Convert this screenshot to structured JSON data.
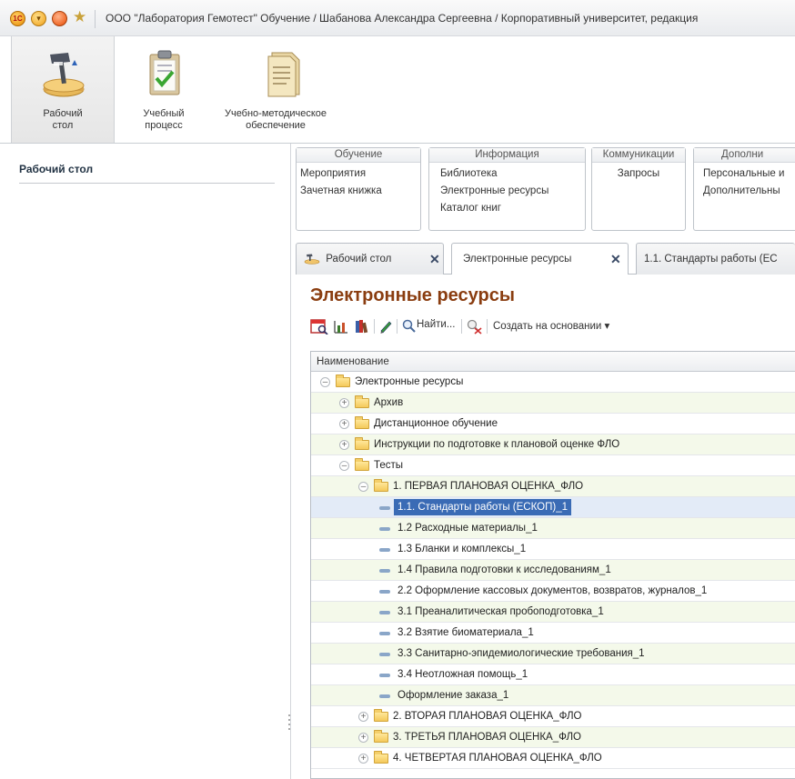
{
  "window": {
    "title": "ООО \"Лаборатория Гемотест\" Обучение / Шабанова Александра Сергеевна / Корпоративный университет, редакция"
  },
  "sections": [
    {
      "label": "Рабочий\nстол",
      "line1": "Рабочий",
      "line2": "стол",
      "icon": "desk-lamp-icon"
    },
    {
      "label": "Учебный процесс",
      "line1": "Учебный",
      "line2": "процесс",
      "icon": "clipboard-check-icon"
    },
    {
      "label": "Учебно-методическое обеспечение",
      "line1": "Учебно-методическое",
      "line2": "обеспечение",
      "icon": "document-icon"
    }
  ],
  "left_panel": {
    "title": "Рабочий стол"
  },
  "groups": [
    {
      "title": "Обучение",
      "items": [
        "Мероприятия",
        "Зачетная книжка"
      ]
    },
    {
      "title": "Информация",
      "items": [
        "Библиотека",
        "Электронные ресурсы",
        "Каталог книг"
      ]
    },
    {
      "title": "Коммуникации",
      "items": [
        "Запросы"
      ]
    },
    {
      "title": "Дополни",
      "items": [
        "Персональные и",
        "Дополнительны"
      ]
    }
  ],
  "tabs": [
    {
      "label": "Рабочий стол",
      "active": false
    },
    {
      "label": "Электронные ресурсы",
      "active": true
    },
    {
      "label": "1.1. Стандарты работы (ЕС",
      "active": false
    }
  ],
  "content": {
    "title": "Электронные ресурсы",
    "toolbar": {
      "find_label": "Найти...",
      "create_based_label": "Создать на основании ▾"
    },
    "grid": {
      "column": "Наименование",
      "rows": [
        {
          "label": "Электронные ресурсы",
          "level": 0,
          "type": "folder",
          "state": "open"
        },
        {
          "label": "Архив",
          "level": 1,
          "type": "folder",
          "state": "closed"
        },
        {
          "label": "Дистанционное обучение",
          "level": 1,
          "type": "folder",
          "state": "closed"
        },
        {
          "label": "Инструкции по подготовке к плановой оценке ФЛО",
          "level": 1,
          "type": "folder",
          "state": "closed"
        },
        {
          "label": "Тесты",
          "level": 1,
          "type": "folder",
          "state": "open"
        },
        {
          "label": "1. ПЕРВАЯ ПЛАНОВАЯ ОЦЕНКА_ФЛО",
          "level": 2,
          "type": "folder",
          "state": "open"
        },
        {
          "label": "1.1. Стандарты работы (ЕСКОП)_1",
          "level": 3,
          "type": "item",
          "selected": true
        },
        {
          "label": "1.2  Расходные материалы_1",
          "level": 3,
          "type": "item"
        },
        {
          "label": "1.3 Бланки и комплексы_1",
          "level": 3,
          "type": "item"
        },
        {
          "label": "1.4 Правила подготовки к исследованиям_1",
          "level": 3,
          "type": "item"
        },
        {
          "label": "2.2 Оформление кассовых документов, возвратов, журналов_1",
          "level": 3,
          "type": "item"
        },
        {
          "label": "3.1 Преаналитическая пробоподготовка_1",
          "level": 3,
          "type": "item"
        },
        {
          "label": "3.2 Взятие биоматериала_1",
          "level": 3,
          "type": "item"
        },
        {
          "label": "3.3 Санитарно-эпидемиологические требования_1",
          "level": 3,
          "type": "item"
        },
        {
          "label": "3.4 Неотложная помощь_1",
          "level": 3,
          "type": "item"
        },
        {
          "label": "Оформление заказа_1",
          "level": 3,
          "type": "item"
        },
        {
          "label": "2. ВТОРАЯ ПЛАНОВАЯ ОЦЕНКА_ФЛО",
          "level": 2,
          "type": "folder",
          "state": "closed"
        },
        {
          "label": "3. ТРЕТЬЯ ПЛАНОВАЯ ОЦЕНКА_ФЛО",
          "level": 2,
          "type": "folder",
          "state": "closed"
        },
        {
          "label": "4. ЧЕТВЕРТАЯ ПЛАНОВАЯ ОЦЕНКА_ФЛО",
          "level": 2,
          "type": "folder",
          "state": "closed"
        }
      ]
    }
  },
  "colors": {
    "title_accent": "#8a3d10",
    "selection": "#3a6bb5",
    "row_alt": "#f4f9ea"
  }
}
